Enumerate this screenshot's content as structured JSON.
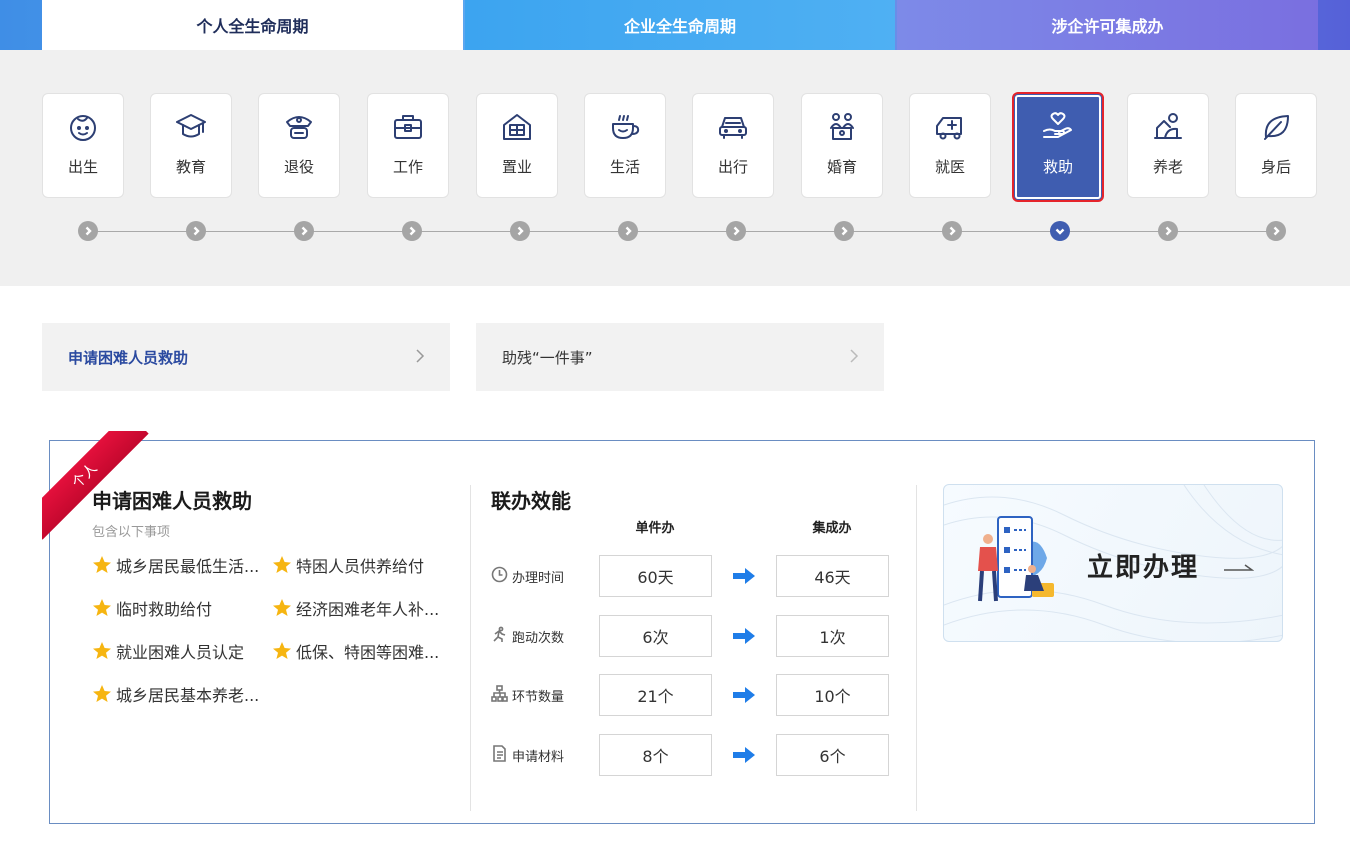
{
  "tabs": [
    {
      "label": "个人全生命周期",
      "active": true
    },
    {
      "label": "企业全生命周期",
      "active": false
    },
    {
      "label": "涉企许可集成办",
      "active": false
    }
  ],
  "stages": [
    {
      "label": "出生",
      "icon": "baby-face-icon"
    },
    {
      "label": "教育",
      "icon": "graduation-cap-icon"
    },
    {
      "label": "退役",
      "icon": "soldier-cap-icon"
    },
    {
      "label": "工作",
      "icon": "briefcase-icon"
    },
    {
      "label": "置业",
      "icon": "house-icon"
    },
    {
      "label": "生活",
      "icon": "coffee-cup-icon"
    },
    {
      "label": "出行",
      "icon": "car-icon"
    },
    {
      "label": "婚育",
      "icon": "family-icon"
    },
    {
      "label": "就医",
      "icon": "ambulance-icon"
    },
    {
      "label": "救助",
      "icon": "hand-heart-icon",
      "active": true
    },
    {
      "label": "养老",
      "icon": "elder-icon"
    },
    {
      "label": "身后",
      "icon": "leaf-icon"
    }
  ],
  "sub_items": [
    {
      "label": "申请困难人员救助",
      "active": true
    },
    {
      "label": "助残“一件事”",
      "active": false
    }
  ],
  "card": {
    "ribbon": "个人",
    "title": "申请困难人员救助",
    "subtitle": "包含以下事项",
    "items": [
      "城乡居民最低生活...",
      "特困人员供养给付",
      "临时救助给付",
      "经济困难老年人补...",
      "就业困难人员认定",
      "低保、特困等困难...",
      "城乡居民基本养老..."
    ],
    "efficiency": {
      "title": "联办效能",
      "col_single": "单件办",
      "col_integrated": "集成办",
      "rows": [
        {
          "label": "办理时间",
          "icon": "clock-icon",
          "single": "60天",
          "integrated": "46天"
        },
        {
          "label": "跑动次数",
          "icon": "run-icon",
          "single": "6次",
          "integrated": "1次"
        },
        {
          "label": "环节数量",
          "icon": "flowchart-icon",
          "single": "21个",
          "integrated": "10个"
        },
        {
          "label": "申请材料",
          "icon": "document-icon",
          "single": "8个",
          "integrated": "6个"
        }
      ]
    },
    "action": {
      "label": "立即办理"
    }
  },
  "colors": {
    "accent": "#3f5db0",
    "highlight": "#e5242b",
    "arrow": "#1f7de8",
    "star": "#f6b511"
  }
}
